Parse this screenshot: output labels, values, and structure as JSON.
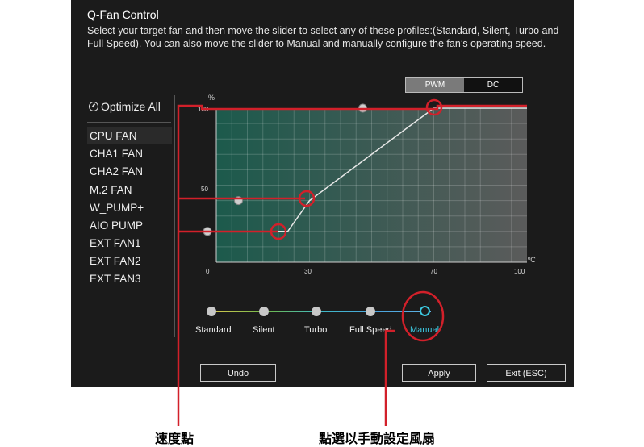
{
  "header": {
    "title": "Q-Fan Control",
    "description": "Select your target fan and then move the slider to select any of these profiles:(Standard, Silent, Turbo and Full Speed). You can also move the slider to Manual and manually configure the fan’s operating speed."
  },
  "mode_toggle": {
    "options": [
      "PWM",
      "DC"
    ],
    "selected": "PWM"
  },
  "optimize_all": "Optimize All",
  "fans": [
    "CPU FAN",
    "CHA1 FAN",
    "CHA2 FAN",
    "M.2 FAN",
    "W_PUMP+",
    "AIO PUMP",
    "EXT FAN1",
    "EXT FAN2",
    "EXT FAN3"
  ],
  "selected_fan": "CPU FAN",
  "chart": {
    "y_unit": "%",
    "x_unit": "ºC",
    "y_ticks": [
      "100",
      "50"
    ],
    "x_ticks": [
      "0",
      "30",
      "70",
      "100"
    ]
  },
  "chart_data": {
    "type": "line",
    "x": [
      20,
      23,
      30,
      70,
      100
    ],
    "y": [
      20,
      20,
      40,
      100,
      100
    ],
    "xlim": [
      0,
      100
    ],
    "ylim": [
      0,
      100
    ],
    "grid": true
  },
  "profiles": [
    "Standard",
    "Silent",
    "Turbo",
    "Full Speed",
    "Manual"
  ],
  "selected_profile": "Manual",
  "buttons": {
    "undo": "Undo",
    "apply": "Apply",
    "exit": "Exit (ESC)"
  },
  "annotations": {
    "speed_points": "速度點",
    "manual_setting": "點選以手動設定風扇"
  },
  "colors": {
    "accent": "#3cc8e0",
    "callout": "#d2202a"
  }
}
